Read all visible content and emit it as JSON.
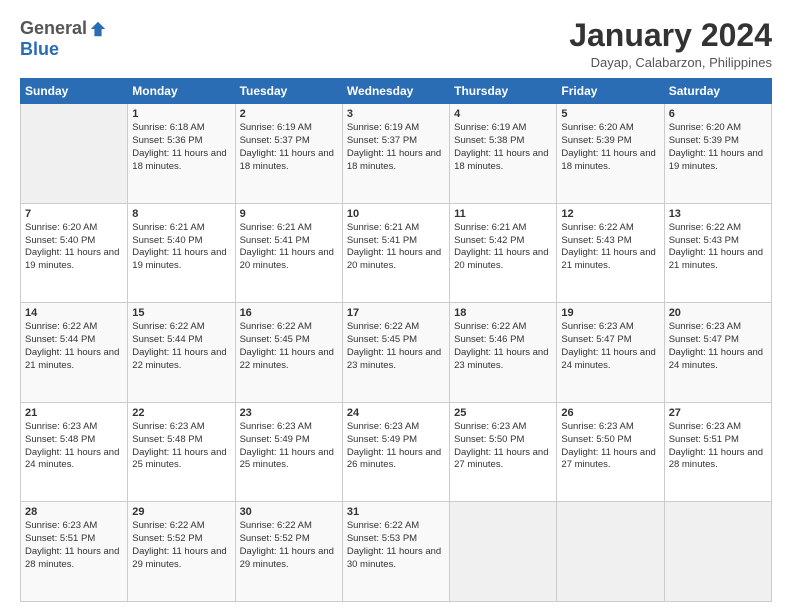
{
  "logo": {
    "general": "General",
    "blue": "Blue"
  },
  "header": {
    "title": "January 2024",
    "location": "Dayap, Calabarzon, Philippines"
  },
  "weekdays": [
    "Sunday",
    "Monday",
    "Tuesday",
    "Wednesday",
    "Thursday",
    "Friday",
    "Saturday"
  ],
  "weeks": [
    [
      {
        "day": "",
        "empty": true
      },
      {
        "day": "1",
        "sunrise": "6:18 AM",
        "sunset": "5:36 PM",
        "daylight": "11 hours and 18 minutes."
      },
      {
        "day": "2",
        "sunrise": "6:19 AM",
        "sunset": "5:37 PM",
        "daylight": "11 hours and 18 minutes."
      },
      {
        "day": "3",
        "sunrise": "6:19 AM",
        "sunset": "5:37 PM",
        "daylight": "11 hours and 18 minutes."
      },
      {
        "day": "4",
        "sunrise": "6:19 AM",
        "sunset": "5:38 PM",
        "daylight": "11 hours and 18 minutes."
      },
      {
        "day": "5",
        "sunrise": "6:20 AM",
        "sunset": "5:39 PM",
        "daylight": "11 hours and 18 minutes."
      },
      {
        "day": "6",
        "sunrise": "6:20 AM",
        "sunset": "5:39 PM",
        "daylight": "11 hours and 19 minutes."
      }
    ],
    [
      {
        "day": "7",
        "sunrise": "6:20 AM",
        "sunset": "5:40 PM",
        "daylight": "11 hours and 19 minutes."
      },
      {
        "day": "8",
        "sunrise": "6:21 AM",
        "sunset": "5:40 PM",
        "daylight": "11 hours and 19 minutes."
      },
      {
        "day": "9",
        "sunrise": "6:21 AM",
        "sunset": "5:41 PM",
        "daylight": "11 hours and 20 minutes."
      },
      {
        "day": "10",
        "sunrise": "6:21 AM",
        "sunset": "5:41 PM",
        "daylight": "11 hours and 20 minutes."
      },
      {
        "day": "11",
        "sunrise": "6:21 AM",
        "sunset": "5:42 PM",
        "daylight": "11 hours and 20 minutes."
      },
      {
        "day": "12",
        "sunrise": "6:22 AM",
        "sunset": "5:43 PM",
        "daylight": "11 hours and 21 minutes."
      },
      {
        "day": "13",
        "sunrise": "6:22 AM",
        "sunset": "5:43 PM",
        "daylight": "11 hours and 21 minutes."
      }
    ],
    [
      {
        "day": "14",
        "sunrise": "6:22 AM",
        "sunset": "5:44 PM",
        "daylight": "11 hours and 21 minutes."
      },
      {
        "day": "15",
        "sunrise": "6:22 AM",
        "sunset": "5:44 PM",
        "daylight": "11 hours and 22 minutes."
      },
      {
        "day": "16",
        "sunrise": "6:22 AM",
        "sunset": "5:45 PM",
        "daylight": "11 hours and 22 minutes."
      },
      {
        "day": "17",
        "sunrise": "6:22 AM",
        "sunset": "5:45 PM",
        "daylight": "11 hours and 23 minutes."
      },
      {
        "day": "18",
        "sunrise": "6:22 AM",
        "sunset": "5:46 PM",
        "daylight": "11 hours and 23 minutes."
      },
      {
        "day": "19",
        "sunrise": "6:23 AM",
        "sunset": "5:47 PM",
        "daylight": "11 hours and 24 minutes."
      },
      {
        "day": "20",
        "sunrise": "6:23 AM",
        "sunset": "5:47 PM",
        "daylight": "11 hours and 24 minutes."
      }
    ],
    [
      {
        "day": "21",
        "sunrise": "6:23 AM",
        "sunset": "5:48 PM",
        "daylight": "11 hours and 24 minutes."
      },
      {
        "day": "22",
        "sunrise": "6:23 AM",
        "sunset": "5:48 PM",
        "daylight": "11 hours and 25 minutes."
      },
      {
        "day": "23",
        "sunrise": "6:23 AM",
        "sunset": "5:49 PM",
        "daylight": "11 hours and 25 minutes."
      },
      {
        "day": "24",
        "sunrise": "6:23 AM",
        "sunset": "5:49 PM",
        "daylight": "11 hours and 26 minutes."
      },
      {
        "day": "25",
        "sunrise": "6:23 AM",
        "sunset": "5:50 PM",
        "daylight": "11 hours and 27 minutes."
      },
      {
        "day": "26",
        "sunrise": "6:23 AM",
        "sunset": "5:50 PM",
        "daylight": "11 hours and 27 minutes."
      },
      {
        "day": "27",
        "sunrise": "6:23 AM",
        "sunset": "5:51 PM",
        "daylight": "11 hours and 28 minutes."
      }
    ],
    [
      {
        "day": "28",
        "sunrise": "6:23 AM",
        "sunset": "5:51 PM",
        "daylight": "11 hours and 28 minutes."
      },
      {
        "day": "29",
        "sunrise": "6:22 AM",
        "sunset": "5:52 PM",
        "daylight": "11 hours and 29 minutes."
      },
      {
        "day": "30",
        "sunrise": "6:22 AM",
        "sunset": "5:52 PM",
        "daylight": "11 hours and 29 minutes."
      },
      {
        "day": "31",
        "sunrise": "6:22 AM",
        "sunset": "5:53 PM",
        "daylight": "11 hours and 30 minutes."
      },
      {
        "day": "",
        "empty": true
      },
      {
        "day": "",
        "empty": true
      },
      {
        "day": "",
        "empty": true
      }
    ]
  ]
}
